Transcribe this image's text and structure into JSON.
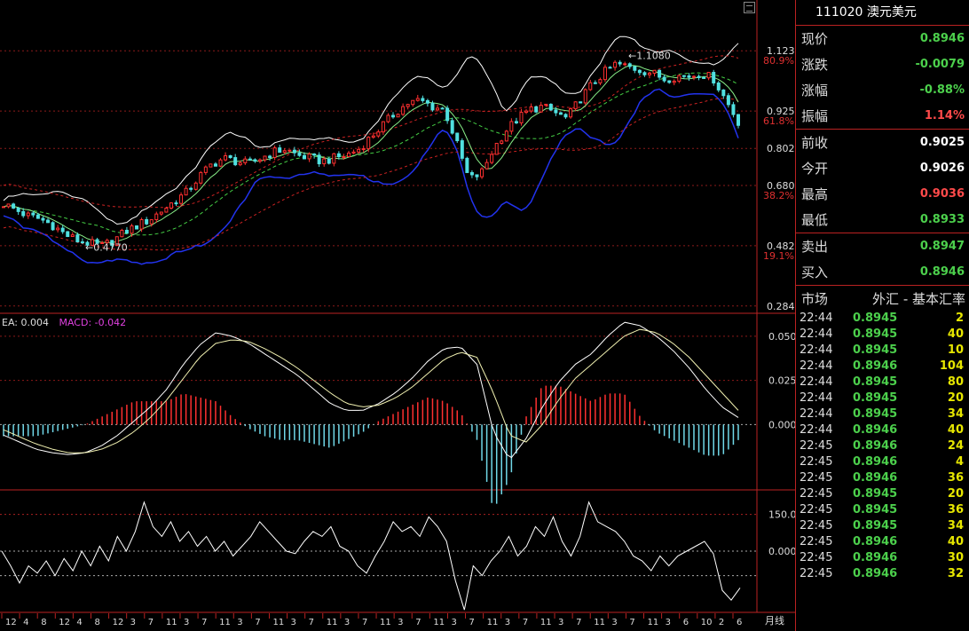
{
  "panel": {
    "title": "111020 澳元美元",
    "quote": [
      {
        "label": "现价",
        "value": "0.8946",
        "color": "#4cd04c"
      },
      {
        "label": "涨跌",
        "value": "-0.0079",
        "color": "#4cd04c"
      },
      {
        "label": "涨幅",
        "value": "-0.88%",
        "color": "#4cd04c"
      },
      {
        "label": "振幅",
        "value": "1.14%",
        "color": "#ff4a4a"
      }
    ],
    "ohlc": [
      {
        "label": "前收",
        "value": "0.9025",
        "color": "#ffffff"
      },
      {
        "label": "今开",
        "value": "0.9026",
        "color": "#ffffff"
      },
      {
        "label": "最高",
        "value": "0.9036",
        "color": "#ff4a4a"
      },
      {
        "label": "最低",
        "value": "0.8933",
        "color": "#4cd04c"
      }
    ],
    "bidask": [
      {
        "label": "卖出",
        "value": "0.8947",
        "color": "#4cd04c"
      },
      {
        "label": "买入",
        "value": "0.8946",
        "color": "#4cd04c"
      }
    ],
    "market_label": "市场",
    "market_value": "外汇 - 基本汇率",
    "ticks": [
      {
        "time": "22:44",
        "price": "0.8945",
        "vol": "2"
      },
      {
        "time": "22:44",
        "price": "0.8945",
        "vol": "40"
      },
      {
        "time": "22:44",
        "price": "0.8945",
        "vol": "10"
      },
      {
        "time": "22:44",
        "price": "0.8946",
        "vol": "104"
      },
      {
        "time": "22:44",
        "price": "0.8945",
        "vol": "80"
      },
      {
        "time": "22:44",
        "price": "0.8945",
        "vol": "20"
      },
      {
        "time": "22:44",
        "price": "0.8945",
        "vol": "34"
      },
      {
        "time": "22:44",
        "price": "0.8946",
        "vol": "40"
      },
      {
        "time": "22:45",
        "price": "0.8946",
        "vol": "24"
      },
      {
        "time": "22:45",
        "price": "0.8946",
        "vol": "4"
      },
      {
        "time": "22:45",
        "price": "0.8946",
        "vol": "36"
      },
      {
        "time": "22:45",
        "price": "0.8945",
        "vol": "20"
      },
      {
        "time": "22:45",
        "price": "0.8945",
        "vol": "36"
      },
      {
        "time": "22:45",
        "price": "0.8945",
        "vol": "34"
      },
      {
        "time": "22:45",
        "price": "0.8946",
        "vol": "40"
      },
      {
        "time": "22:45",
        "price": "0.8946",
        "vol": "30"
      },
      {
        "time": "22:45",
        "price": "0.8946",
        "vol": "32"
      }
    ]
  },
  "chart_data": [
    {
      "type": "candlestick",
      "period_label": "月线",
      "price_ticks": [
        1.123,
        0.925,
        0.802,
        0.68,
        0.482,
        0.284
      ],
      "fib_labels": [
        "80.9%",
        "61.8%",
        "38.2%",
        "19.1%"
      ],
      "annotations": {
        "high": "1.1080",
        "low": "0.4770"
      },
      "ylim": [
        0.26,
        1.29
      ],
      "close_path": [
        0.62,
        0.6,
        0.58,
        0.57,
        0.55,
        0.52,
        0.5,
        0.49,
        0.48,
        0.5,
        0.53,
        0.55,
        0.57,
        0.6,
        0.63,
        0.66,
        0.71,
        0.75,
        0.77,
        0.76,
        0.75,
        0.77,
        0.79,
        0.8,
        0.78,
        0.77,
        0.76,
        0.77,
        0.78,
        0.8,
        0.84,
        0.88,
        0.92,
        0.95,
        0.96,
        0.94,
        0.93,
        0.82,
        0.7,
        0.72,
        0.8,
        0.86,
        0.9,
        0.93,
        0.94,
        0.92,
        0.9,
        0.96,
        1.01,
        1.05,
        1.08,
        1.07,
        1.06,
        1.05,
        1.03,
        1.04,
        1.04,
        1.05,
        1.03,
        0.96,
        0.89
      ]
    },
    {
      "type": "macd",
      "title_prefix": "EA: ",
      "dea_value": "0.004",
      "macd_label": "MACD: ",
      "macd_value": "-0.042",
      "ticks": [
        0.05,
        0.025,
        0.0
      ],
      "ylim": [
        -0.037,
        0.063
      ],
      "diff_path": [
        -0.006,
        -0.01,
        -0.014,
        -0.016,
        -0.017,
        -0.016,
        -0.012,
        -0.006,
        0.002,
        0.01,
        0.02,
        0.034,
        0.045,
        0.052,
        0.05,
        0.046,
        0.04,
        0.034,
        0.028,
        0.02,
        0.012,
        0.008,
        0.008,
        0.012,
        0.018,
        0.026,
        0.036,
        0.043,
        0.044,
        0.034,
        -0.004,
        -0.02,
        -0.008,
        0.01,
        0.024,
        0.034,
        0.04,
        0.05,
        0.058,
        0.056,
        0.05,
        0.042,
        0.032,
        0.02,
        0.01,
        0.004
      ],
      "dea_path": [
        -0.003,
        -0.007,
        -0.011,
        -0.014,
        -0.016,
        -0.016,
        -0.014,
        -0.01,
        -0.004,
        0.004,
        0.014,
        0.026,
        0.038,
        0.046,
        0.048,
        0.047,
        0.043,
        0.038,
        0.032,
        0.025,
        0.018,
        0.012,
        0.01,
        0.011,
        0.015,
        0.021,
        0.029,
        0.037,
        0.041,
        0.038,
        0.018,
        -0.006,
        -0.01,
        0.0,
        0.014,
        0.026,
        0.034,
        0.042,
        0.05,
        0.054,
        0.052,
        0.046,
        0.038,
        0.028,
        0.018,
        0.008
      ]
    },
    {
      "type": "line",
      "ticks": [
        "150.0",
        "0.000"
      ],
      "tick_values": [
        150,
        0
      ],
      "ylim": [
        -250,
        250
      ],
      "path": [
        0,
        -60,
        -130,
        -60,
        -90,
        -40,
        -100,
        -30,
        -80,
        0,
        -60,
        20,
        -40,
        60,
        0,
        80,
        200,
        100,
        60,
        120,
        40,
        80,
        20,
        60,
        0,
        40,
        -20,
        20,
        60,
        120,
        80,
        40,
        0,
        -10,
        40,
        80,
        60,
        100,
        20,
        0,
        -60,
        -90,
        -20,
        40,
        120,
        80,
        100,
        60,
        140,
        100,
        40,
        -120,
        -240,
        -60,
        -100,
        -40,
        0,
        60,
        -20,
        20,
        100,
        60,
        140,
        40,
        -20,
        60,
        200,
        120,
        100,
        80,
        40,
        -20,
        -40,
        -80,
        -20,
        -60,
        -20,
        0,
        20,
        40,
        -10,
        -160,
        -200,
        -150
      ]
    }
  ],
  "x_axis": [
    "12",
    "4",
    "8",
    "12",
    "4",
    "8",
    "12",
    "3",
    "7",
    "11",
    "3",
    "7",
    "11",
    "3",
    "7",
    "11",
    "3",
    "7",
    "11",
    "3",
    "7",
    "11",
    "3",
    "7",
    "11",
    "3",
    "7",
    "11",
    "3",
    "7",
    "11",
    "3",
    "7",
    "11",
    "3",
    "7",
    "11",
    "3",
    "6",
    "10",
    "2",
    "6"
  ]
}
